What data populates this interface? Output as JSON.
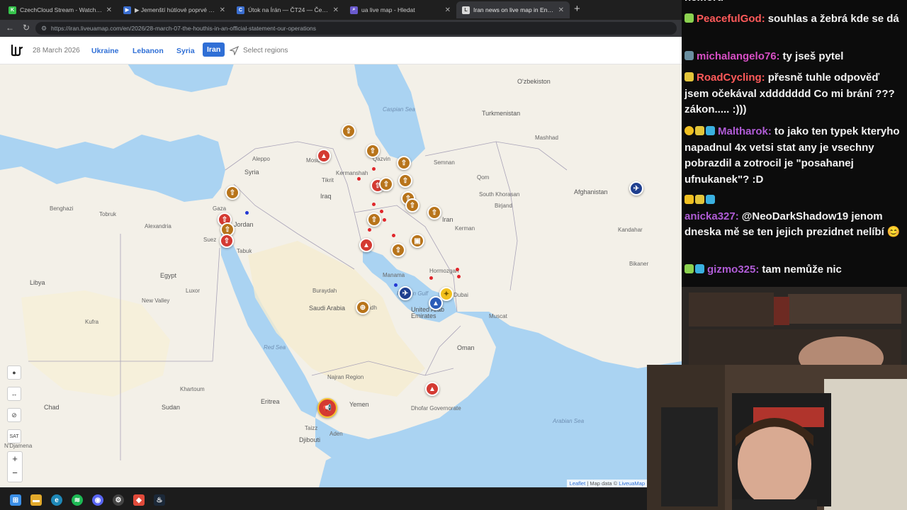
{
  "tabs": [
    {
      "title": "CzechCloud Stream - Watch Live o",
      "icon": "K",
      "color": "#36c44c"
    },
    {
      "title": "▶ Jemenští hútíové poprvé od zač",
      "icon": "▶",
      "color": "#3a6ed0"
    },
    {
      "title": "Útok na Írán — ČT24 — Česká tele",
      "icon": "C",
      "color": "#3a6ed0"
    },
    {
      "title": "ua live map - Hledat",
      "icon": "⌕",
      "color": "#6a5acd"
    },
    {
      "title": "Iran news on live map in English -",
      "icon": "L",
      "color": "#d9d9d9"
    }
  ],
  "browser": {
    "url": "https://iran.liveuamap.com/en/2026/28-march-07-the-houthis-in-an-official-statement-our-operations"
  },
  "site": {
    "date": "28 March 2026",
    "regions": [
      "Ukraine",
      "Lebanon",
      "Syria",
      "Iran"
    ],
    "active_region": "Iran",
    "select_regions": "Select regions"
  },
  "map": {
    "countries": {
      "iraq": "Iraq",
      "syria": "Syria",
      "iran": "Iran",
      "saudi": "Saudi Arabia",
      "egypt": "Egypt",
      "libya": "Libya",
      "sudan": "Sudan",
      "chad": "Chad",
      "yemen": "Yemen",
      "oman": "Oman",
      "uae": "United Arab Emirates",
      "turkmenistan": "Turkmenistan",
      "uzbekistan": "O'zbekiston",
      "afghanistan": "Afghanistan",
      "jordan": "Jordan",
      "eritrea": "Eritrea",
      "djibouti": "Djibouti"
    },
    "places": {
      "mosul": "Mosul",
      "aleppo": "Aleppo",
      "tikrit": "Tikrit",
      "kermanshah": "Kermanshah",
      "qazvin": "Qazvin",
      "semnan": "Semnan",
      "qom": "Qom",
      "kerman": "Kerman",
      "tabuk": "Tabuk",
      "buraydah": "Buraydah",
      "riyadh": "Riyadh",
      "manama": "Manama",
      "luxor": "Luxor",
      "alexandria": "Alexandria",
      "suez": "Suez",
      "aden": "Aden",
      "dubai": "Dubai",
      "muscat": "Muscat",
      "birjand": "Birjand",
      "mashhad": "Mashhad",
      "kandahar": "Kandahar",
      "bikaner": "Bikaner",
      "khartoum": "Khartoum",
      "najran": "Najran Region",
      "hormozgan": "Hormozgan",
      "khorasan": "South Khorasan",
      "tobruk": "Tobruk",
      "benghazi": "Benghazi",
      "new_valley": "New Valley",
      "kuffra": "Kufra",
      "dhofar": "Dhofar Governorate",
      "ndjamena": "N'Djamena",
      "taizz": "Taizz",
      "gaza": "Gaza"
    },
    "water": {
      "caspian": "Caspian Sea",
      "arabian": "Arabian Sea",
      "red": "Red Sea",
      "gulf": "Persian Gulf"
    },
    "controls": {
      "zoom_in": "+",
      "zoom_out": "−",
      "sat": "SAT"
    },
    "attribution": {
      "leaflet": "Leaflet",
      "sep": " | Map data © ",
      "provider": "LiveuaMap"
    }
  },
  "chat": [
    {
      "user": "",
      "text": "nemoru",
      "color": "#f2f2f2"
    },
    {
      "user": "PeacefulGod:",
      "text": "souhlas a žebrá kde se dá",
      "color": "#ff5a5a",
      "badges": [
        "#8bd14f"
      ]
    },
    {
      "user": "michalangelo76:",
      "text": "ty jseš pytel",
      "color": "#d64fc4",
      "badges": [
        "#6a8fa0"
      ]
    },
    {
      "user": "RoadCycling:",
      "text": "přesně tuhle odpověď jsem očekával xddddddd Co mi brání ??? zákon..... :)))",
      "color": "#ff5a5a",
      "badges": [
        "#e3c53a"
      ]
    },
    {
      "user": "Maltharok:",
      "text": "to jako ten typek kteryho napadnul 4x vetsi stat any je vsechny pobrazdil a zotrocil je \"posahanej ufnukanek\"? :D",
      "color": "#b05cd6",
      "badges": [
        "#f0c020",
        "#e3c53a",
        "#3ab0e0"
      ]
    },
    {
      "user": "anicka327:",
      "text": "@NeoDarkShadow19 jenom dneska mě se ten jejich prezidnet nelíbí 😊",
      "color": "#b05cd6",
      "badges": [
        "#f0c020",
        "#e3c53a",
        "#3ab0e0"
      ]
    },
    {
      "user": "gizmo325:",
      "text": "tam nemůže nic",
      "color": "#b05cd6",
      "badges": [
        "#8bd14f",
        "#3ab0e0"
      ]
    }
  ]
}
